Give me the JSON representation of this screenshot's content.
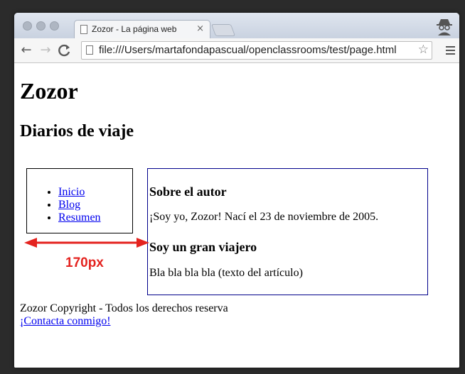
{
  "browser": {
    "tab_title": "Zozor - La página web",
    "tab_close": "×",
    "url": "file:///Users/martafondapascual/openclassrooms/test/page.html",
    "nav": {
      "back": "←",
      "forward": "→",
      "reload": "C"
    },
    "star": "☆"
  },
  "page": {
    "site_title": "Zozor",
    "tagline": "Diarios de viaje",
    "nav_links": [
      "Inicio",
      "Blog",
      "Resumen"
    ],
    "article": {
      "heading1": "Sobre el autor",
      "paragraph1": "¡Soy yo, Zozor! Nací el 23 de noviembre de 2005.",
      "heading2": "Soy un gran viajero",
      "paragraph2": "Bla bla bla bla (texto del artículo)"
    },
    "footer": {
      "copyright": "Zozor Copyright - Todos los derechos reserva",
      "contact_link": "¡Contacta conmigo!"
    }
  },
  "annotation": {
    "label": "170px",
    "color": "#e4231f"
  },
  "colors": {
    "link": "#0000ee",
    "section_border": "#00008b"
  }
}
